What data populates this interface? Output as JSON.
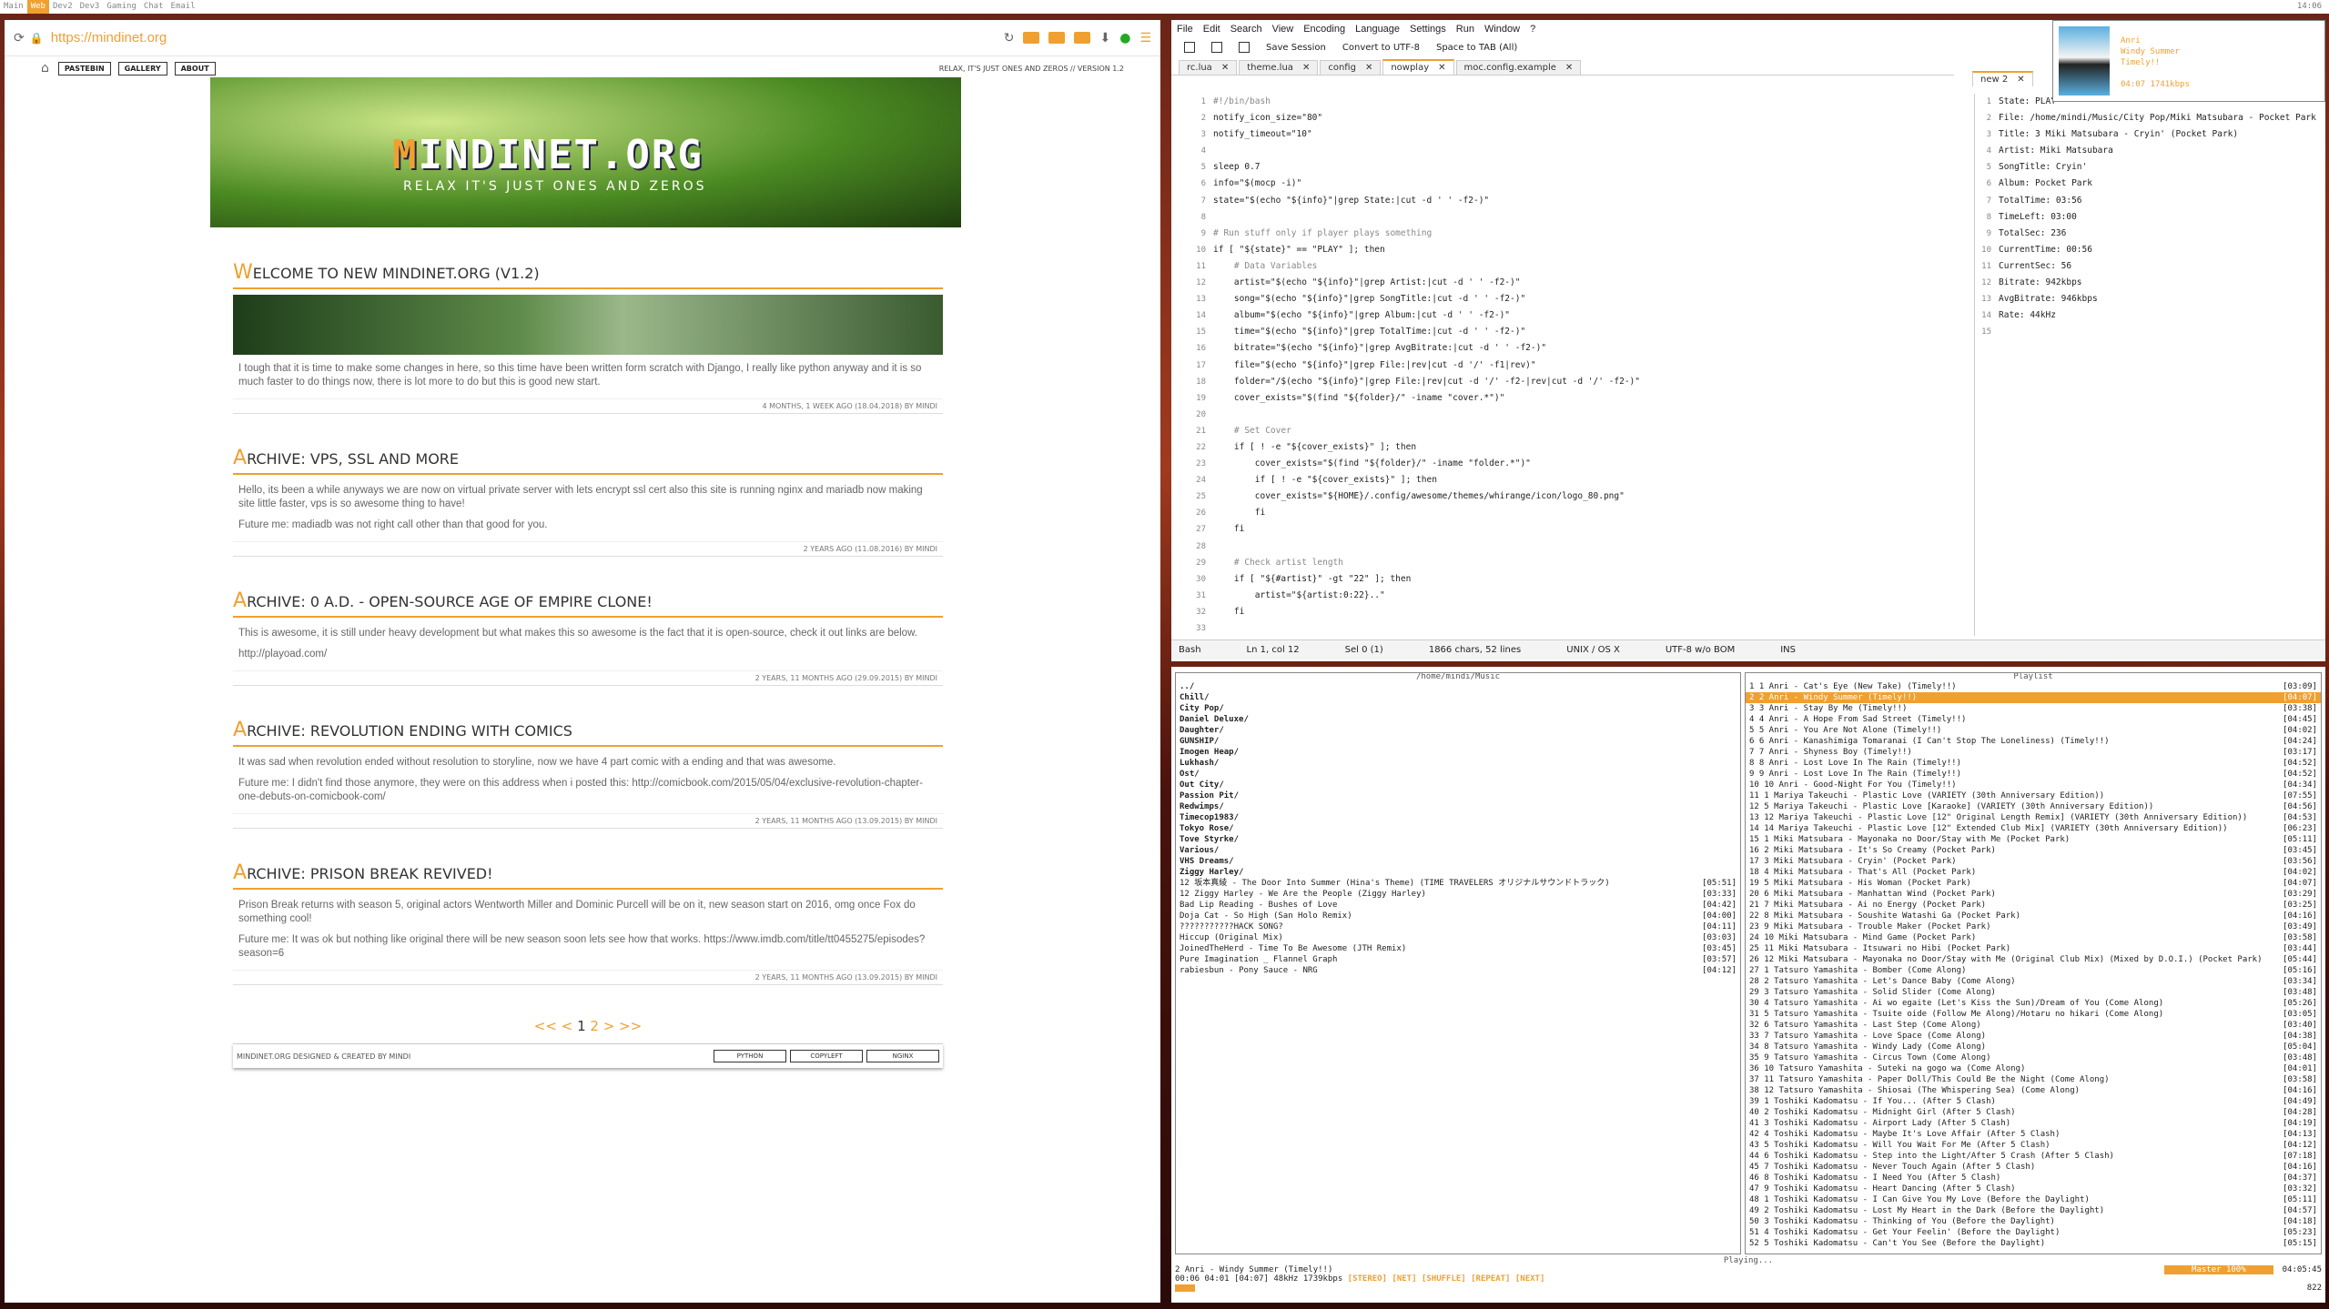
{
  "topbar": {
    "tags": [
      "Main",
      "Web",
      "Dev2",
      "Dev3",
      "Gaming",
      "Chat",
      "Email"
    ],
    "active": 1,
    "clock": "14:06"
  },
  "browser": {
    "url": "https://mindinet.org",
    "nav": [
      "PASTEBIN",
      "GALLERY",
      "ABOUT"
    ],
    "motto": "RELAX, IT'S JUST ONES AND ZEROS // VERSION 1.2",
    "logo_cap": "M",
    "logo_rest": "INDINET.ORG",
    "logo_sub": "RELAX IT'S JUST ONES AND ZEROS",
    "posts": [
      {
        "cap": "W",
        "title": "ELCOME TO NEW MINDINET.ORG (V1.2)",
        "paras": [
          "I tough that it is time to make some changes in here, so this time have been written form scratch with Django, I really like python anyway and it is so much faster to do things now, there is lot more to do but this is good new start."
        ],
        "meta": "4 MONTHS, 1 WEEK AGO (18.04.2018) BY MINDI",
        "img": true
      },
      {
        "cap": "A",
        "title": "RCHIVE: VPS, SSL AND MORE",
        "paras": [
          "Hello, its been a while anyways we are now on virtual private server with lets encrypt ssl cert also this site is running nginx and mariadb now making site little faster, vps is so awesome thing to have!",
          "Future me: madiadb was not right call other than that good for you."
        ],
        "meta": "2 YEARS AGO (11.08.2016) BY MINDI"
      },
      {
        "cap": "A",
        "title": "RCHIVE: 0 A.D. - OPEN-SOURCE AGE OF EMPIRE CLONE!",
        "paras": [
          "This is awesome, it is still under heavy development but what makes this so awesome is the fact that it is open-source, check it out links are below.",
          "http://playoad.com/"
        ],
        "meta": "2 YEARS, 11 MONTHS AGO (29.09.2015) BY MINDI"
      },
      {
        "cap": "A",
        "title": "RCHIVE: REVOLUTION ENDING WITH COMICS",
        "paras": [
          "It was sad when revolution ended without resolution to storyline, now we have 4 part comic with a ending and that was awesome.",
          "Future me: I didn't find those anymore, they were on this address when i posted this: http://comicbook.com/2015/05/04/exclusive-revolution-chapter-one-debuts-on-comicbook-com/"
        ],
        "meta": "2 YEARS, 11 MONTHS AGO (13.09.2015) BY MINDI"
      },
      {
        "cap": "A",
        "title": "RCHIVE: PRISON BREAK REVIVED!",
        "paras": [
          "Prison Break returns with season 5, original actors Wentworth Miller and Dominic Purcell will be on it, new season start on 2016, omg once Fox do something cool!",
          "Future me: It was ok but nothing like original there will be new season soon lets see how that works. https://www.imdb.com/title/tt0455275/episodes?season=6"
        ],
        "meta": "2 YEARS, 11 MONTHS AGO (13.09.2015) BY MINDI"
      }
    ],
    "pager": {
      "prev": "<< <",
      "cur": "1",
      "next": "2",
      "rest": "> >>"
    },
    "footer": "MINDINET.ORG DESIGNED & CREATED BY MINDI",
    "badges": [
      "PYTHON",
      "COPYLEFT",
      "NGINX"
    ]
  },
  "npp": {
    "menu": [
      "File",
      "Edit",
      "Search",
      "View",
      "Encoding",
      "Language",
      "Settings",
      "Run",
      "Window",
      "?"
    ],
    "toolbar": [
      "Save Session",
      "Convert to UTF-8",
      "Space to TAB (All)"
    ],
    "tabs": [
      "rc.lua",
      "theme.lua",
      "config",
      "nowplay",
      "moc.config.example"
    ],
    "active_tab": 3,
    "right_tab": "new 2",
    "code": [
      "#!/bin/bash",
      "notify_icon_size=\"80\"",
      "notify_timeout=\"10\"",
      "",
      "sleep 0.7",
      "info=\"$(mocp -i)\"",
      "state=\"$(echo \"${info}\"|grep State:|cut -d ' ' -f2-)\"",
      "",
      "# Run stuff only if player plays something",
      "if [ \"${state}\" == \"PLAY\" ]; then",
      "    # Data Variables",
      "    artist=\"$(echo \"${info}\"|grep Artist:|cut -d ' ' -f2-)\"",
      "    song=\"$(echo \"${info}\"|grep SongTitle:|cut -d ' ' -f2-)\"",
      "    album=\"$(echo \"${info}\"|grep Album:|cut -d ' ' -f2-)\"",
      "    time=\"$(echo \"${info}\"|grep TotalTime:|cut -d ' ' -f2-)\"",
      "    bitrate=\"$(echo \"${info}\"|grep AvgBitrate:|cut -d ' ' -f2-)\"",
      "    file=\"$(echo \"${info}\"|grep File:|rev|cut -d '/' -f1|rev)\"",
      "    folder=\"/$(echo \"${info}\"|grep File:|rev|cut -d '/' -f2-|rev|cut -d '/' -f2-)\"",
      "    cover_exists=\"$(find \"${folder}/\" -iname \"cover.*\")\"",
      "",
      "    # Set Cover",
      "    if [ ! -e \"${cover_exists}\" ]; then",
      "        cover_exists=\"$(find \"${folder}/\" -iname \"folder.*\")\"",
      "        if [ ! -e \"${cover_exists}\" ]; then",
      "        cover_exists=\"${HOME}/.config/awesome/themes/whirange/icon/logo_80.png\"",
      "        fi",
      "    fi",
      "",
      "    # Check artist length",
      "    if [ \"${#artist}\" -gt \"22\" ]; then",
      "        artist=\"${artist:0:22}..\"",
      "    fi",
      "    "
    ],
    "right": [
      "State: PLAY",
      "File: /home/mindi/Music/City Pop/Miki Matsubara - Pocket Park",
      "Title: 3 Miki Matsubara - Cryin' (Pocket Park)",
      "Artist: Miki Matsubara",
      "SongTitle: Cryin'",
      "Album: Pocket Park",
      "TotalTime: 03:56",
      "TimeLeft: 03:00",
      "TotalSec: 236",
      "CurrentTime: 00:56",
      "CurrentSec: 56",
      "Bitrate: 942kbps",
      "AvgBitrate: 946kbps",
      "Rate: 44kHz",
      ""
    ],
    "status": [
      "Bash",
      "Ln 1, col 12",
      "Sel 0 (1)",
      "1866 chars, 52 lines",
      "UNIX / OS X",
      "UTF-8 w/o BOM",
      "INS"
    ]
  },
  "moc": {
    "dir_title": "/home/mindi/Music",
    "pl_title": "Playlist",
    "dirs": [
      "../",
      "Chill/",
      "City Pop/",
      "Daniel Deluxe/",
      "Daughter/",
      "GUNSHIP/",
      "Imogen Heap/",
      "Lukhash/",
      "Ost/",
      "Out City/",
      "Passion Pit/",
      "Redwimps/",
      "Timecop1983/",
      "Tokyo Rose/",
      "Tove Styrke/",
      "Various/",
      "VHS Dreams/",
      "Ziggy Harley/"
    ],
    "files": [
      [
        "12 坂本真綾 - The Door Into Summer (Hina's Theme) (TIME TRAVELERS オリジナルサウンドトラック)",
        "05:51"
      ],
      [
        "12 Ziggy Harley - We Are the People (Ziggy Harley)",
        "03:33"
      ],
      [
        "Bad Lip Reading - Bushes of Love",
        "04:42"
      ],
      [
        "Doja Cat - So High (San Holo Remix)",
        "04:00"
      ],
      [
        "???????????HACK SONG?",
        "04:11"
      ],
      [
        "Hiccup (Original Mix)",
        "03:03"
      ],
      [
        "JoinedTheHerd - Time To Be Awesome (JTH Remix)",
        "03:45"
      ],
      [
        "Pure Imagination _ Flannel Graph",
        "03:57"
      ],
      [
        "rabiesbun - Pony Sauce - NRG",
        "04:12"
      ]
    ],
    "playlist": [
      [
        "1 1 Anri - Cat's Eye (New Take) (Timely!!)",
        "03:09"
      ],
      [
        "2 2 Anri - Windy Summer (Timely!!)",
        "04:07"
      ],
      [
        "3 3 Anri - Stay By Me (Timely!!)",
        "03:38"
      ],
      [
        "4 4 Anri - A Hope From Sad Street (Timely!!)",
        "04:45"
      ],
      [
        "5 5 Anri - You Are Not Alone (Timely!!)",
        "04:02"
      ],
      [
        "6 6 Anri - Kanashimiga Tomaranai (I Can't Stop The Loneliness) (Timely!!)",
        "04:24"
      ],
      [
        "7 7 Anri - Shyness Boy (Timely!!)",
        "03:17"
      ],
      [
        "8 8 Anri - Lost Love In The Rain (Timely!!)",
        "04:52"
      ],
      [
        "9 9 Anri - Lost Love In The Rain (Timely!!)",
        "04:52"
      ],
      [
        "10 10 Anri - Good-Night For You (Timely!!)",
        "04:34"
      ],
      [
        "11 1 Mariya Takeuchi - Plastic Love (VARIETY (30th Anniversary Edition))",
        "07:55"
      ],
      [
        "12 5 Mariya Takeuchi - Plastic Love [Karaoke] (VARIETY (30th Anniversary Edition))",
        "04:56"
      ],
      [
        "13 12 Mariya Takeuchi - Plastic Love [12\" Original Length Remix] (VARIETY (30th Anniversary Edition))",
        "04:53"
      ],
      [
        "14 14 Mariya Takeuchi - Plastic Love [12\" Extended Club Mix] (VARIETY (30th Anniversary Edition))",
        "06:23"
      ],
      [
        "15 1 Miki Matsubara - Mayonaka no Door/Stay with Me (Pocket Park)",
        "05:11"
      ],
      [
        "16 2 Miki Matsubara - It's So Creamy (Pocket Park)",
        "03:45"
      ],
      [
        "17 3 Miki Matsubara - Cryin' (Pocket Park)",
        "03:56"
      ],
      [
        "18 4 Miki Matsubara - That's All (Pocket Park)",
        "04:02"
      ],
      [
        "19 5 Miki Matsubara - His Woman (Pocket Park)",
        "04:07"
      ],
      [
        "20 6 Miki Matsubara - Manhattan Wind (Pocket Park)",
        "03:29"
      ],
      [
        "21 7 Miki Matsubara - Ai no Energy (Pocket Park)",
        "03:25"
      ],
      [
        "22 8 Miki Matsubara - Soushite Watashi Ga (Pocket Park)",
        "04:16"
      ],
      [
        "23 9 Miki Matsubara - Trouble Maker (Pocket Park)",
        "03:49"
      ],
      [
        "24 10 Miki Matsubara - Mind Game (Pocket Park)",
        "03:58"
      ],
      [
        "25 11 Miki Matsubara - Itsuwari no Hibi (Pocket Park)",
        "03:44"
      ],
      [
        "26 12 Miki Matsubara - Mayonaka no Door/Stay with Me (Original Club Mix) (Mixed by D.O.I.) (Pocket Park)",
        "05:44"
      ],
      [
        "27 1 Tatsuro Yamashita - Bomber (Come Along)",
        "05:16"
      ],
      [
        "28 2 Tatsuro Yamashita - Let's Dance Baby (Come Along)",
        "03:34"
      ],
      [
        "29 3 Tatsuro Yamashita - Solid Slider (Come Along)",
        "03:48"
      ],
      [
        "30 4 Tatsuro Yamashita - Ai wo egaite (Let's Kiss the Sun)/Dream of You (Come Along)",
        "05:26"
      ],
      [
        "31 5 Tatsuro Yamashita - Tsuite oide (Follow Me Along)/Hotaru no hikari (Come Along)",
        "03:05"
      ],
      [
        "32 6 Tatsuro Yamashita - Last Step (Come Along)",
        "03:40"
      ],
      [
        "33 7 Tatsuro Yamashita - Love Space (Come Along)",
        "04:38"
      ],
      [
        "34 8 Tatsuro Yamashita - Windy Lady (Come Along)",
        "05:04"
      ],
      [
        "35 9 Tatsuro Yamashita - Circus Town (Come Along)",
        "03:48"
      ],
      [
        "36 10 Tatsuro Yamashita - Suteki na gogo wa (Come Along)",
        "04:01"
      ],
      [
        "37 11 Tatsuro Yamashita - Paper Doll/This Could Be the Night (Come Along)",
        "03:58"
      ],
      [
        "38 12 Tatsuro Yamashita - Shiosai (The Whispering Sea) (Come Along)",
        "04:16"
      ],
      [
        "39 1 Toshiki Kadomatsu - If You... (After 5 Clash)",
        "04:49"
      ],
      [
        "40 2 Toshiki Kadomatsu - Midnight Girl (After 5 Clash)",
        "04:28"
      ],
      [
        "41 3 Toshiki Kadomatsu - Airport Lady (After 5 Clash)",
        "04:19"
      ],
      [
        "42 4 Toshiki Kadomatsu - Maybe It's Love Affair (After 5 Clash)",
        "04:13"
      ],
      [
        "43 5 Toshiki Kadomatsu - Will You Wait For Me (After 5 Clash)",
        "04:12"
      ],
      [
        "44 6 Toshiki Kadomatsu - Step into the Light/After 5 Crash (After 5 Clash)",
        "07:18"
      ],
      [
        "45 7 Toshiki Kadomatsu - Never Touch Again (After 5 Clash)",
        "04:16"
      ],
      [
        "46 8 Toshiki Kadomatsu - I Need You (After 5 Clash)",
        "04:37"
      ],
      [
        "47 9 Toshiki Kadomatsu - Heart Dancing (After 5 Clash)",
        "03:32"
      ],
      [
        "48 1 Toshiki Kadomatsu - I Can Give You My Love (Before the Daylight)",
        "05:11"
      ],
      [
        "49 2 Toshiki Kadomatsu - Lost My Heart in the Dark (Before the Daylight)",
        "04:57"
      ],
      [
        "50 3 Toshiki Kadomatsu - Thinking of You (Before the Daylight)",
        "04:18"
      ],
      [
        "51 4 Toshiki Kadomatsu - Get Your Feelin' (Before the Daylight)",
        "05:23"
      ],
      [
        "52 5 Toshiki Kadomatsu - Can't You See (Before the Daylight)",
        "05:15"
      ]
    ],
    "playing": "Playing...",
    "current": "2 Anri - Windy Summer (Timely!!)",
    "times": "00:06  04:01  [04:07]",
    "rate": "48kHz 1739kbps",
    "flags": "[STEREO] [NET] [SHUFFLE] [REPEAT] [NEXT]",
    "theme": "Master 100%",
    "total": "04:05:45",
    "count": "822"
  },
  "notify": {
    "artist": "Anri",
    "song": "Windy Summer",
    "album": "Timely!!",
    "time": "04:07 1741kbps"
  },
  "colors": {
    "accent": "#f0a030"
  }
}
